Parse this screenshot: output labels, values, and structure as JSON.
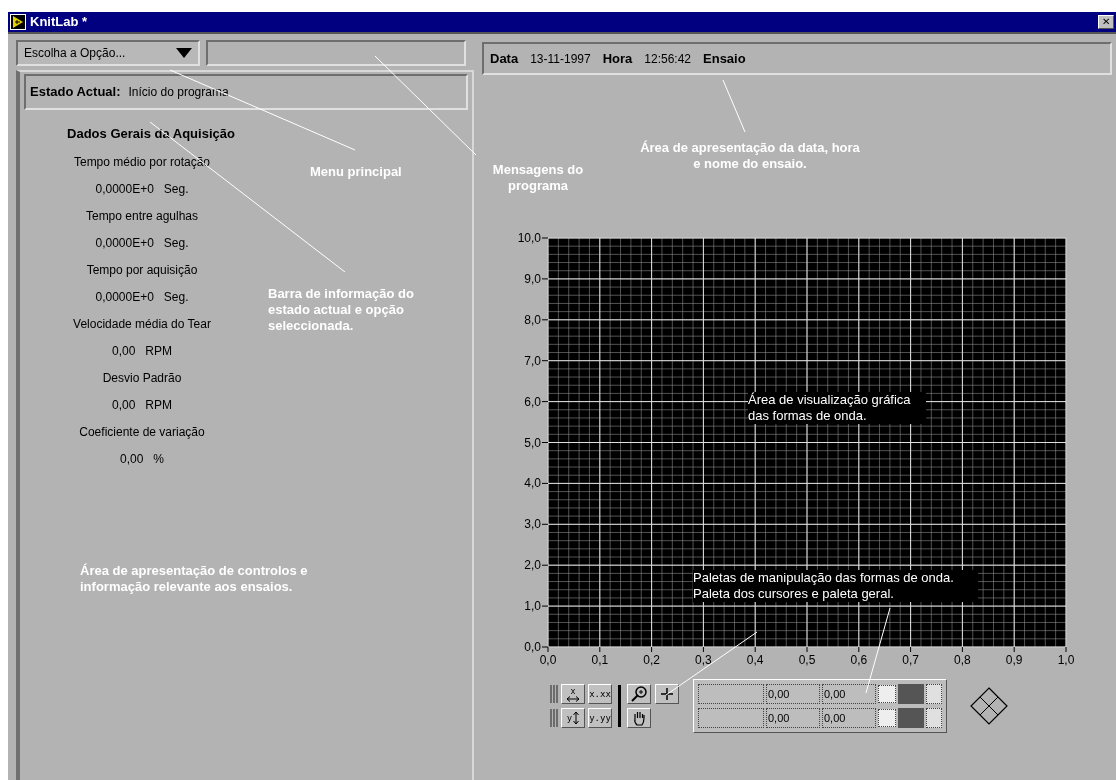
{
  "window": {
    "title": "KnitLab *",
    "close": "✕"
  },
  "option_menu": {
    "label": "Escolha a Opção..."
  },
  "status": {
    "label": "Estado Actual:",
    "value": "Início do programa"
  },
  "info_bar": {
    "date_label": "Data",
    "date": "13-11-1997",
    "time_label": "Hora",
    "time": "12:56:42",
    "test_label": "Ensaio"
  },
  "acquisition": {
    "title": "Dados Gerais da Aquisição",
    "items": [
      {
        "label": "Tempo médio por rotação",
        "value": "0,0000E+0",
        "unit": "Seg."
      },
      {
        "label": "Tempo entre agulhas",
        "value": "0,0000E+0",
        "unit": "Seg."
      },
      {
        "label": "Tempo por aquisição",
        "value": "0,0000E+0",
        "unit": "Seg."
      },
      {
        "label": "Velocidade média do Tear",
        "value": "0,00",
        "unit": "RPM"
      },
      {
        "label": "Desvio Padrão",
        "value": "0,00",
        "unit": "RPM"
      },
      {
        "label": "Coeficiente de variação",
        "value": "0,00",
        "unit": "%"
      }
    ]
  },
  "chart": {
    "chart_data": {
      "type": "line",
      "grid": true,
      "xlim": [
        0,
        1
      ],
      "ylim": [
        0,
        10
      ],
      "xticks": [
        {
          "value": 0,
          "label": "0,0"
        },
        {
          "value": 0.1,
          "label": "0,1"
        },
        {
          "value": 0.2,
          "label": "0,2"
        },
        {
          "value": 0.3,
          "label": "0,3"
        },
        {
          "value": 0.4,
          "label": "0,4"
        },
        {
          "value": 0.5,
          "label": "0,5"
        },
        {
          "value": 0.6,
          "label": "0,6"
        },
        {
          "value": 0.7,
          "label": "0,7"
        },
        {
          "value": 0.8,
          "label": "0,8"
        },
        {
          "value": 0.9,
          "label": "0,9"
        },
        {
          "value": 1,
          "label": "1,0"
        }
      ],
      "yticks": [
        {
          "value": 0,
          "label": "0,0"
        },
        {
          "value": 1,
          "label": "1,0"
        },
        {
          "value": 2,
          "label": "2,0"
        },
        {
          "value": 3,
          "label": "3,0"
        },
        {
          "value": 4,
          "label": "4,0"
        },
        {
          "value": 5,
          "label": "5,0"
        },
        {
          "value": 6,
          "label": "6,0"
        },
        {
          "value": 7,
          "label": "7,0"
        },
        {
          "value": 8,
          "label": "8,0"
        },
        {
          "value": 9,
          "label": "9,0"
        },
        {
          "value": 10,
          "label": "10,0"
        }
      ]
    }
  },
  "palette": {
    "x_format": "x.xx",
    "y_format": "y.yy",
    "x_label": "x",
    "y_label": "y"
  },
  "cursors": [
    {
      "value_1": "0,00",
      "value_2": "0,00"
    },
    {
      "value_1": "0,00",
      "value_2": "0,00"
    }
  ],
  "callouts": [
    {
      "text": "Menu principal"
    },
    {
      "text": "Mensagens do programa"
    },
    {
      "text": "Área de apresentação da data, hora e nome do ensaio."
    },
    {
      "text": "Barra de informação do estado actual e opção seleccionada."
    },
    {
      "text": "Área de apresentação de controlos e informação relevante aos ensaios."
    },
    {
      "text": "Área de visualização gráfica das formas de onda."
    },
    {
      "text": "Paletas de manipulação das formas de onda. Paleta dos cursores e paleta geral."
    }
  ]
}
